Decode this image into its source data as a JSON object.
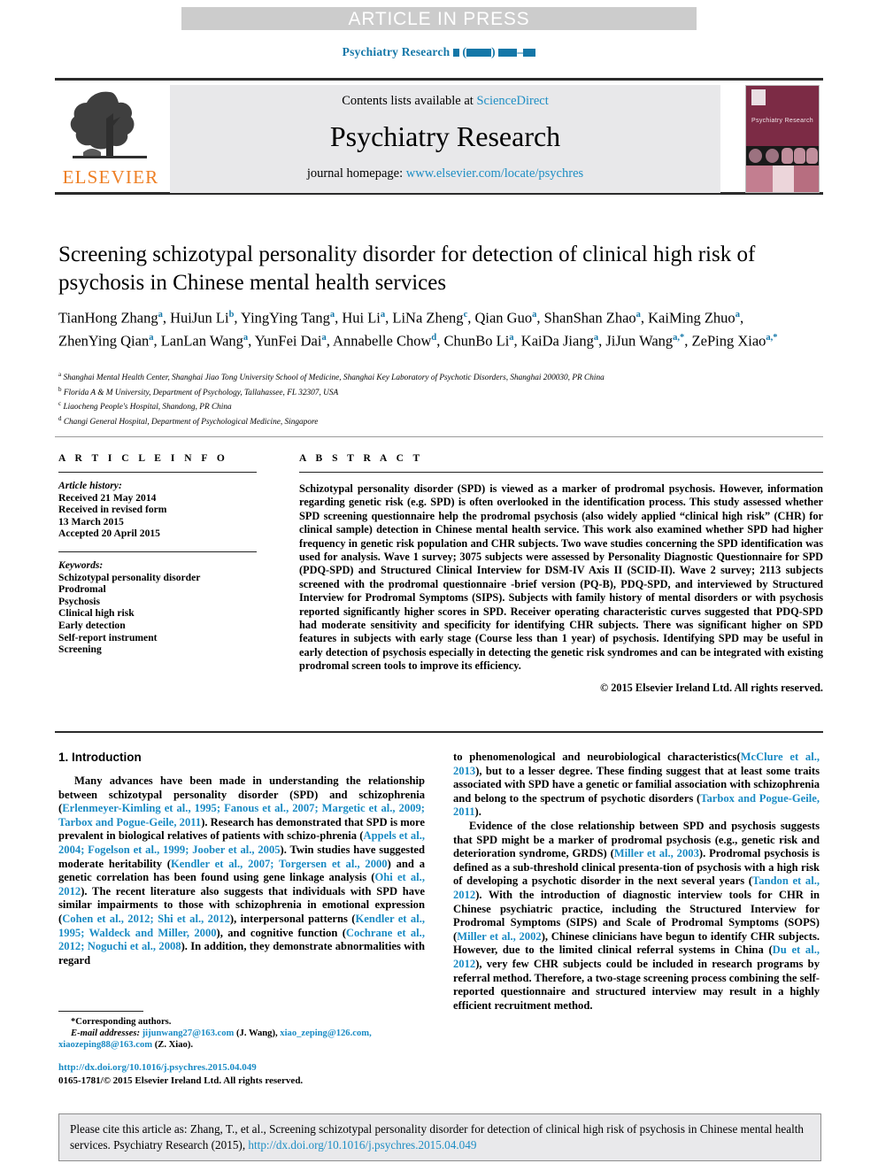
{
  "banner": {
    "label": "ARTICLE IN PRESS"
  },
  "running_head": {
    "journal": "Psychiatry Research"
  },
  "masthead": {
    "publisher": "ELSEVIER",
    "contents_prefix": "Contents lists available at ",
    "contents_link": "ScienceDirect",
    "journal_title": "Psychiatry Research",
    "homepage_prefix": "journal homepage: ",
    "homepage_link": "www.elsevier.com/locate/psychres",
    "cover_name": "Psychiatry Research",
    "cover_color": "#7c2b45"
  },
  "article": {
    "title": "Screening schizotypal personality disorder for detection of clinical high risk of psychosis in Chinese mental health services",
    "authors_line1": "TianHong Zhang",
    "authors_html": "TianHong Zhang<sup>a</sup>, HuiJun Li<sup>b</sup>, YingYing Tang<sup>a</sup>, Hui Li<sup>a</sup>, LiNa Zheng<sup>c</sup>, Qian Guo<sup>a</sup>, ShanShan Zhao<sup>a</sup>, KaiMing Zhuo<sup>a</sup>, ZhenYing Qian<sup>a</sup>, LanLan Wang<sup>a</sup>, YunFei Dai<sup>a</sup>, Annabelle Chow<sup>d</sup>, ChunBo Li<sup>a</sup>, KaiDa Jiang<sup>a</sup>, JiJun Wang<sup>a,*</sup>, ZePing Xiao<sup>a,*</sup>",
    "affiliations": [
      {
        "mark": "a",
        "text": "Shanghai Mental Health Center, Shanghai Jiao Tong University School of Medicine, Shanghai Key Laboratory of Psychotic Disorders, Shanghai 200030, PR China"
      },
      {
        "mark": "b",
        "text": "Florida A & M University, Department of Psychology, Tallahassee, FL 32307, USA"
      },
      {
        "mark": "c",
        "text": "Liaocheng People's Hospital, Shandong, PR China"
      },
      {
        "mark": "d",
        "text": "Changi General Hospital, Department of Psychological Medicine, Singapore"
      }
    ]
  },
  "article_info": {
    "heading": "A R T I C L E  I N F O",
    "history_label": "Article history:",
    "history": [
      "Received 21 May 2014",
      "Received in revised form",
      "13 March 2015",
      "Accepted 20 April 2015"
    ],
    "keywords_label": "Keywords:",
    "keywords": [
      "Schizotypal personality disorder",
      "Prodromal",
      "Psychosis",
      "Clinical high risk",
      "Early detection",
      "Self-report instrument",
      "Screening"
    ]
  },
  "abstract": {
    "heading": "A B S T R A C T",
    "text": "Schizotypal personality disorder (SPD) is viewed as a marker of prodromal psychosis. However, information regarding genetic risk (e.g. SPD) is often overlooked in the identification process. This study assessed whether SPD screening questionnaire help the prodromal psychosis (also widely applied “clinical high risk” (CHR) for clinical sample) detection in Chinese mental health service. This work also examined whether SPD had higher frequency in genetic risk population and CHR subjects. Two wave studies concerning the SPD identification was used for analysis. Wave 1 survey; 3075 subjects were assessed by Personality Diagnostic Questionnaire for SPD (PDQ-SPD) and Structured Clinical Interview for DSM-IV Axis II (SCID-II). Wave 2 survey; 2113 subjects screened with the prodromal questionnaire -brief version (PQ-B), PDQ-SPD, and interviewed by Structured Interview for Prodromal Symptoms (SIPS). Subjects with family history of mental disorders or with psychosis reported significantly higher scores in SPD. Receiver operating characteristic curves suggested that PDQ-SPD had moderate sensitivity and specificity for identifying CHR subjects. There was significant higher on SPD features in subjects with early stage (Course less than 1 year) of psychosis. Identifying SPD may be useful in early detection of psychosis especially in detecting the genetic risk syndromes and can be integrated with existing prodromal screen tools to improve its efficiency.",
    "copyright": "© 2015 Elsevier Ireland Ltd. All rights reserved."
  },
  "introduction": {
    "heading": "1.  Introduction",
    "left_paragraph_1": "Many advances have been made in understanding the relationship between schizotypal personality disorder (SPD) and schizophrenia (<span class=\"ref\">Erlenmeyer-Kimling et al., 1995; Fanous et al., 2007; Margetic et al., 2009; Tarbox and Pogue-Geile, 2011</span>). Research has demonstrated that SPD is more prevalent in biological relatives of patients with schizo-phrenia (<span class=\"ref\">Appels et al., 2004; Fogelson et al., 1999; Joober et al., 2005</span>). Twin studies have suggested moderate heritability (<span class=\"ref\">Kendler et al., 2007; Torgersen et al., 2000</span>) and a genetic correlation has been found using gene linkage analysis (<span class=\"ref\">Ohi et al., 2012</span>). The recent literature also suggests that individuals with SPD have similar impairments to those with schizophrenia in emotional expression (<span class=\"ref\">Cohen et al., 2012; Shi et al., 2012</span>), interpersonal patterns (<span class=\"ref\">Kendler et al., 1995; Waldeck and Miller, 2000</span>), and cognitive function (<span class=\"ref\">Cochrane et al., 2012; Noguchi et al., 2008</span>). In addition, they demonstrate abnormalities with regard",
    "right_paragraph_1": "to phenomenological and neurobiological characteristics(<span class=\"ref\">McClure et al., 2013</span>), but to a lesser degree. These finding suggest that at least some traits associated with SPD have a genetic or familial association with schizophrenia and belong to the spectrum of psychotic disorders (<span class=\"ref\">Tarbox and Pogue-Geile, 2011</span>).",
    "right_paragraph_2": "Evidence of the close relationship between SPD and psychosis suggests that SPD might be a marker of prodromal psychosis (e.g., genetic risk and deterioration syndrome, GRDS) (<span class=\"ref\">Miller et al., 2003</span>). Prodromal psychosis is defined as a sub-threshold clinical presenta-tion of psychosis with a high risk of developing a psychotic disorder in the next several years (<span class=\"ref\">Tandon et al., 2012</span>). With the introduction of diagnostic interview tools for CHR in Chinese psychiatric practice, including the Structured Interview for Prodromal Symptoms (SIPS) and Scale of Prodromal Symptoms (SOPS) (<span class=\"ref\">Miller et al., 2002</span>), Chinese clinicians have begun to identify CHR subjects. However, due to the limited clinical referral systems in China (<span class=\"ref\">Du et al., 2012</span>), very few CHR subjects could be included in research programs by referral method. Therefore, a two-stage screening process combining the self-reported questionnaire and structured interview may result in a highly efficient recruitment method."
  },
  "footnote": {
    "corresponding": "*Corresponding authors.",
    "email_label": "E-mail addresses:",
    "email_1": "jijunwang27@163.com",
    "email_1_owner": "(J. Wang),",
    "email_2": "xiao_zeping@126.com,",
    "email_3": "xiaozeping88@163.com",
    "email_3_owner": "(Z. Xiao)."
  },
  "doi_block": {
    "doi_url": "http://dx.doi.org/10.1016/j.psychres.2015.04.049",
    "issn_line": "0165-1781/© 2015 Elsevier Ireland Ltd. All rights reserved."
  },
  "cite_box": {
    "text_before": "Please cite this article as: Zhang, T., et al., Screening schizotypal personality disorder for detection of clinical high risk of psychosis in Chinese mental health services. Psychiatry Research (2015), ",
    "link": "http://dx.doi.org/10.1016/j.psychres.2015.04.049"
  },
  "colors": {
    "link": "#1e8ec4",
    "reference": "#1a8bc4",
    "banner_bg": "#cccccc",
    "elsevier_orange": "#ee7f24",
    "panel_bg": "#e8e8ea"
  }
}
